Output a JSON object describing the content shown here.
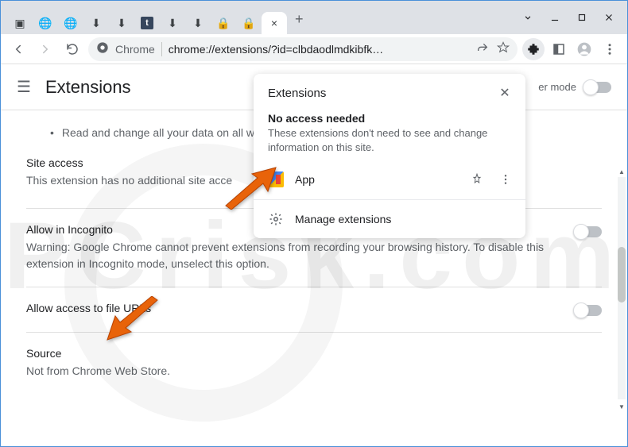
{
  "window": {
    "tabs_icons": [
      "intercom",
      "globe",
      "globe",
      "download",
      "download",
      "tumblr",
      "download",
      "download",
      "lock",
      "lock"
    ],
    "active_tab_close": "×",
    "newtab": "+"
  },
  "toolbar": {
    "omnibox": {
      "scheme": "Chrome",
      "url": "chrome://extensions/?id=clbdaodlmdkibfk…"
    }
  },
  "page": {
    "title": "Extensions",
    "devmode_label": "er mode",
    "bullet_text": "Read and change all your data on all w",
    "site_access": {
      "title": "Site access",
      "sub": "This extension has no additional site acce"
    },
    "incognito": {
      "title": "Allow in Incognito",
      "sub": "Warning: Google Chrome cannot prevent extensions from recording your browsing history. To disable this extension in Incognito mode, unselect this option."
    },
    "file_urls": {
      "title": "Allow access to file URLs"
    },
    "source": {
      "title": "Source",
      "sub": "Not from Chrome Web Store."
    }
  },
  "popup": {
    "title": "Extensions",
    "section_title": "No access needed",
    "section_sub": "These extensions don't need to see and change information on this site.",
    "item_label": "App",
    "manage_label": "Manage extensions"
  },
  "watermark": "PCrisk.com"
}
